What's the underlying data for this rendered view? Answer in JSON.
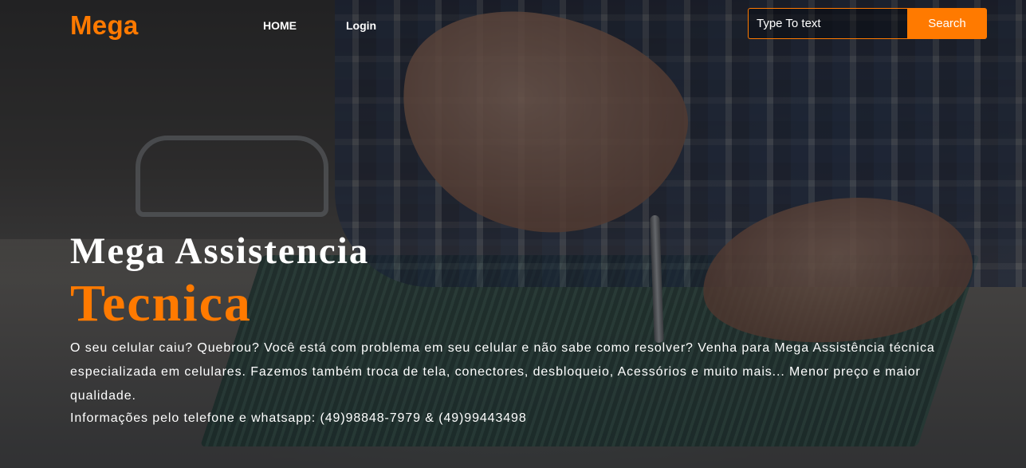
{
  "navbar": {
    "brand": "Mega",
    "links": [
      {
        "label": "HOME"
      },
      {
        "label": "Login"
      }
    ],
    "search": {
      "placeholder": "Type To text",
      "button_label": "Search"
    }
  },
  "hero": {
    "title": "Mega Assistencia",
    "subtitle": "Tecnica",
    "description": "O seu celular caiu? Quebrou? Você está com problema em seu celular e não sabe como resolver? Venha para Mega Assistência técnica especializada em celulares. Fazemos também troca de tela, conectores, desbloqueio, Acessórios e muito mais... Menor preço e maior qualidade.",
    "contact": "Informações pelo telefone e whatsapp: (49)98848-7979 & (49)99443498"
  },
  "colors": {
    "accent": "#ff7a00",
    "text": "#ffffff",
    "overlay": "#0c0e12"
  }
}
